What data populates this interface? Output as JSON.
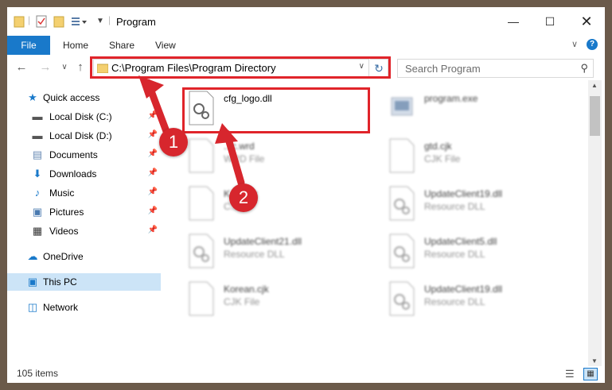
{
  "window": {
    "title": "Program"
  },
  "ribbon": {
    "tabs": [
      "File",
      "Home",
      "Share",
      "View"
    ]
  },
  "address": {
    "path": "C:\\Program Files\\Program Directory"
  },
  "search": {
    "placeholder": "Search Program"
  },
  "sidebar": {
    "items": [
      {
        "label": "Quick access",
        "icon": "star-icon"
      },
      {
        "label": "Local Disk (C:)",
        "icon": "drive-icon",
        "pinned": true
      },
      {
        "label": "Local Disk (D:)",
        "icon": "drive-icon",
        "pinned": true
      },
      {
        "label": "Documents",
        "icon": "documents-icon",
        "pinned": true
      },
      {
        "label": "Downloads",
        "icon": "downloads-icon",
        "pinned": true
      },
      {
        "label": "Music",
        "icon": "music-icon",
        "pinned": true
      },
      {
        "label": "Pictures",
        "icon": "pictures-icon",
        "pinned": true
      },
      {
        "label": "Videos",
        "icon": "videos-icon",
        "pinned": true
      },
      {
        "label": "OneDrive",
        "icon": "onedrive-icon"
      },
      {
        "label": "This PC",
        "icon": "pc-icon",
        "selected": true
      },
      {
        "label": "Network",
        "icon": "network-icon"
      }
    ]
  },
  "files": [
    {
      "name": "cfg_logo.dll",
      "type": ""
    },
    {
      "name": "program.exe",
      "type": ""
    },
    {
      "name": "...c.wrd",
      "type": "WRD File"
    },
    {
      "name": "gtd.cjk",
      "type": "CJK File"
    },
    {
      "name": "K...n.cjk",
      "type": "C..."
    },
    {
      "name": "UpdateClient19.dll",
      "type": "Resource DLL"
    },
    {
      "name": "UpdateClient21.dll",
      "type": "Resource DLL"
    },
    {
      "name": "UpdateClient5.dll",
      "type": "Resource DLL"
    },
    {
      "name": "Korean.cjk",
      "type": "CJK File"
    },
    {
      "name": "UpdateClient19.dll",
      "type": "Resource DLL"
    }
  ],
  "status": {
    "item_count": "105 items"
  },
  "annotations": {
    "badge1": "1",
    "badge2": "2"
  },
  "colors": {
    "accent": "#1979ca",
    "highlight": "#e0242a",
    "selected": "#cce4f7"
  }
}
